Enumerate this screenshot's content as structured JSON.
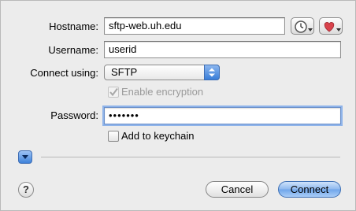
{
  "form": {
    "hostname_label": "Hostname:",
    "hostname_value": "sftp-web.uh.edu",
    "username_label": "Username:",
    "username_value": "userid",
    "connect_label": "Connect using:",
    "connect_value": "SFTP",
    "encryption_label": "Enable encryption",
    "encryption_checked": true,
    "encryption_enabled": false,
    "password_label": "Password:",
    "password_value": "•••••••",
    "keychain_label": "Add to keychain",
    "keychain_checked": false
  },
  "icons": {
    "history": "clock-icon",
    "favorites": "heart-icon",
    "disclosure": "disclosure-triangle-icon",
    "help": "help-icon"
  },
  "buttons": {
    "help_label": "?",
    "cancel_label": "Cancel",
    "connect_label": "Connect"
  },
  "colors": {
    "accent": "#3e82da",
    "focus_ring": "#8fb4ea",
    "heart": "#d9434c"
  }
}
